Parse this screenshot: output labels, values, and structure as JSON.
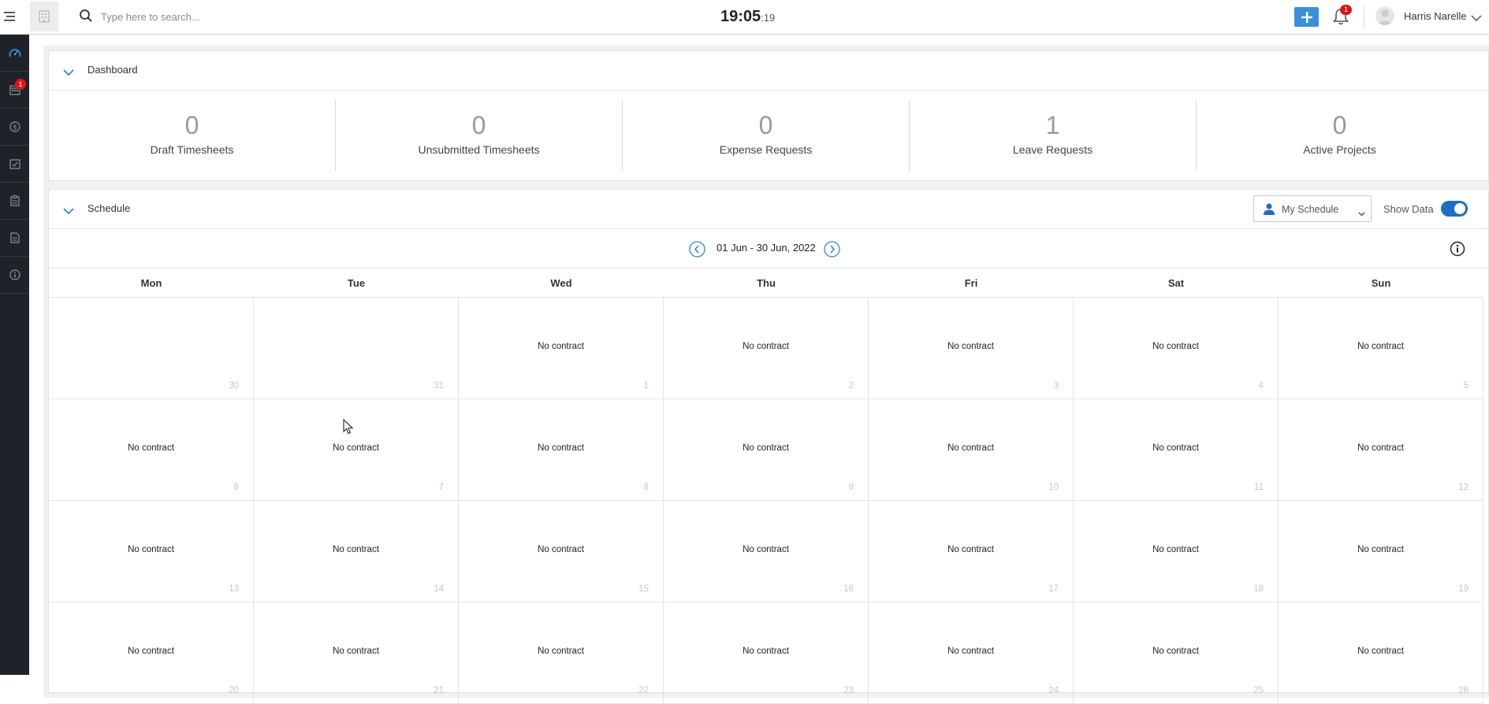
{
  "topbar": {
    "search_placeholder": "Type here to search...",
    "clock_hm": "19:05",
    "clock_s": ":19",
    "notification_count": "1",
    "user_name": "Harris Narelle"
  },
  "sidebar": {
    "items": [
      {
        "icon": "dashboard-gauge-icon"
      },
      {
        "icon": "calendar-icon",
        "badge": "1"
      },
      {
        "icon": "dollar-icon"
      },
      {
        "icon": "task-check-icon"
      },
      {
        "icon": "clipboard-icon"
      },
      {
        "icon": "document-icon"
      },
      {
        "icon": "info-icon"
      }
    ]
  },
  "dashboard": {
    "title": "Dashboard",
    "stats": [
      {
        "value": "0",
        "label": "Draft Timesheets"
      },
      {
        "value": "0",
        "label": "Unsubmitted Timesheets"
      },
      {
        "value": "0",
        "label": "Expense Requests"
      },
      {
        "value": "1",
        "label": "Leave Requests"
      },
      {
        "value": "0",
        "label": "Active Projects"
      }
    ]
  },
  "schedule": {
    "title": "Schedule",
    "view_select": "My Schedule",
    "show_data_label": "Show Data",
    "show_data_on": true,
    "range": "01 Jun - 30 Jun, 2022",
    "weekdays": [
      "Mon",
      "Tue",
      "Wed",
      "Thu",
      "Fri",
      "Sat",
      "Sun"
    ],
    "weeks": [
      [
        {
          "day": "30",
          "text": ""
        },
        {
          "day": "31",
          "text": ""
        },
        {
          "day": "1",
          "text": "No contract"
        },
        {
          "day": "2",
          "text": "No contract"
        },
        {
          "day": "3",
          "text": "No contract"
        },
        {
          "day": "4",
          "text": "No contract"
        },
        {
          "day": "5",
          "text": "No contract"
        }
      ],
      [
        {
          "day": "6",
          "text": "No contract"
        },
        {
          "day": "7",
          "text": "No contract"
        },
        {
          "day": "8",
          "text": "No contract"
        },
        {
          "day": "9",
          "text": "No contract"
        },
        {
          "day": "10",
          "text": "No contract"
        },
        {
          "day": "11",
          "text": "No contract"
        },
        {
          "day": "12",
          "text": "No contract"
        }
      ],
      [
        {
          "day": "13",
          "text": "No contract"
        },
        {
          "day": "14",
          "text": "No contract"
        },
        {
          "day": "15",
          "text": "No contract"
        },
        {
          "day": "16",
          "text": "No contract"
        },
        {
          "day": "17",
          "text": "No contract"
        },
        {
          "day": "18",
          "text": "No contract"
        },
        {
          "day": "19",
          "text": "No contract"
        }
      ],
      [
        {
          "day": "20",
          "text": "No contract"
        },
        {
          "day": "21",
          "text": "No contract"
        },
        {
          "day": "22",
          "text": "No contract"
        },
        {
          "day": "23",
          "text": "No contract"
        },
        {
          "day": "24",
          "text": "No contract"
        },
        {
          "day": "25",
          "text": "No contract"
        },
        {
          "day": "26",
          "text": "No contract"
        }
      ]
    ]
  }
}
